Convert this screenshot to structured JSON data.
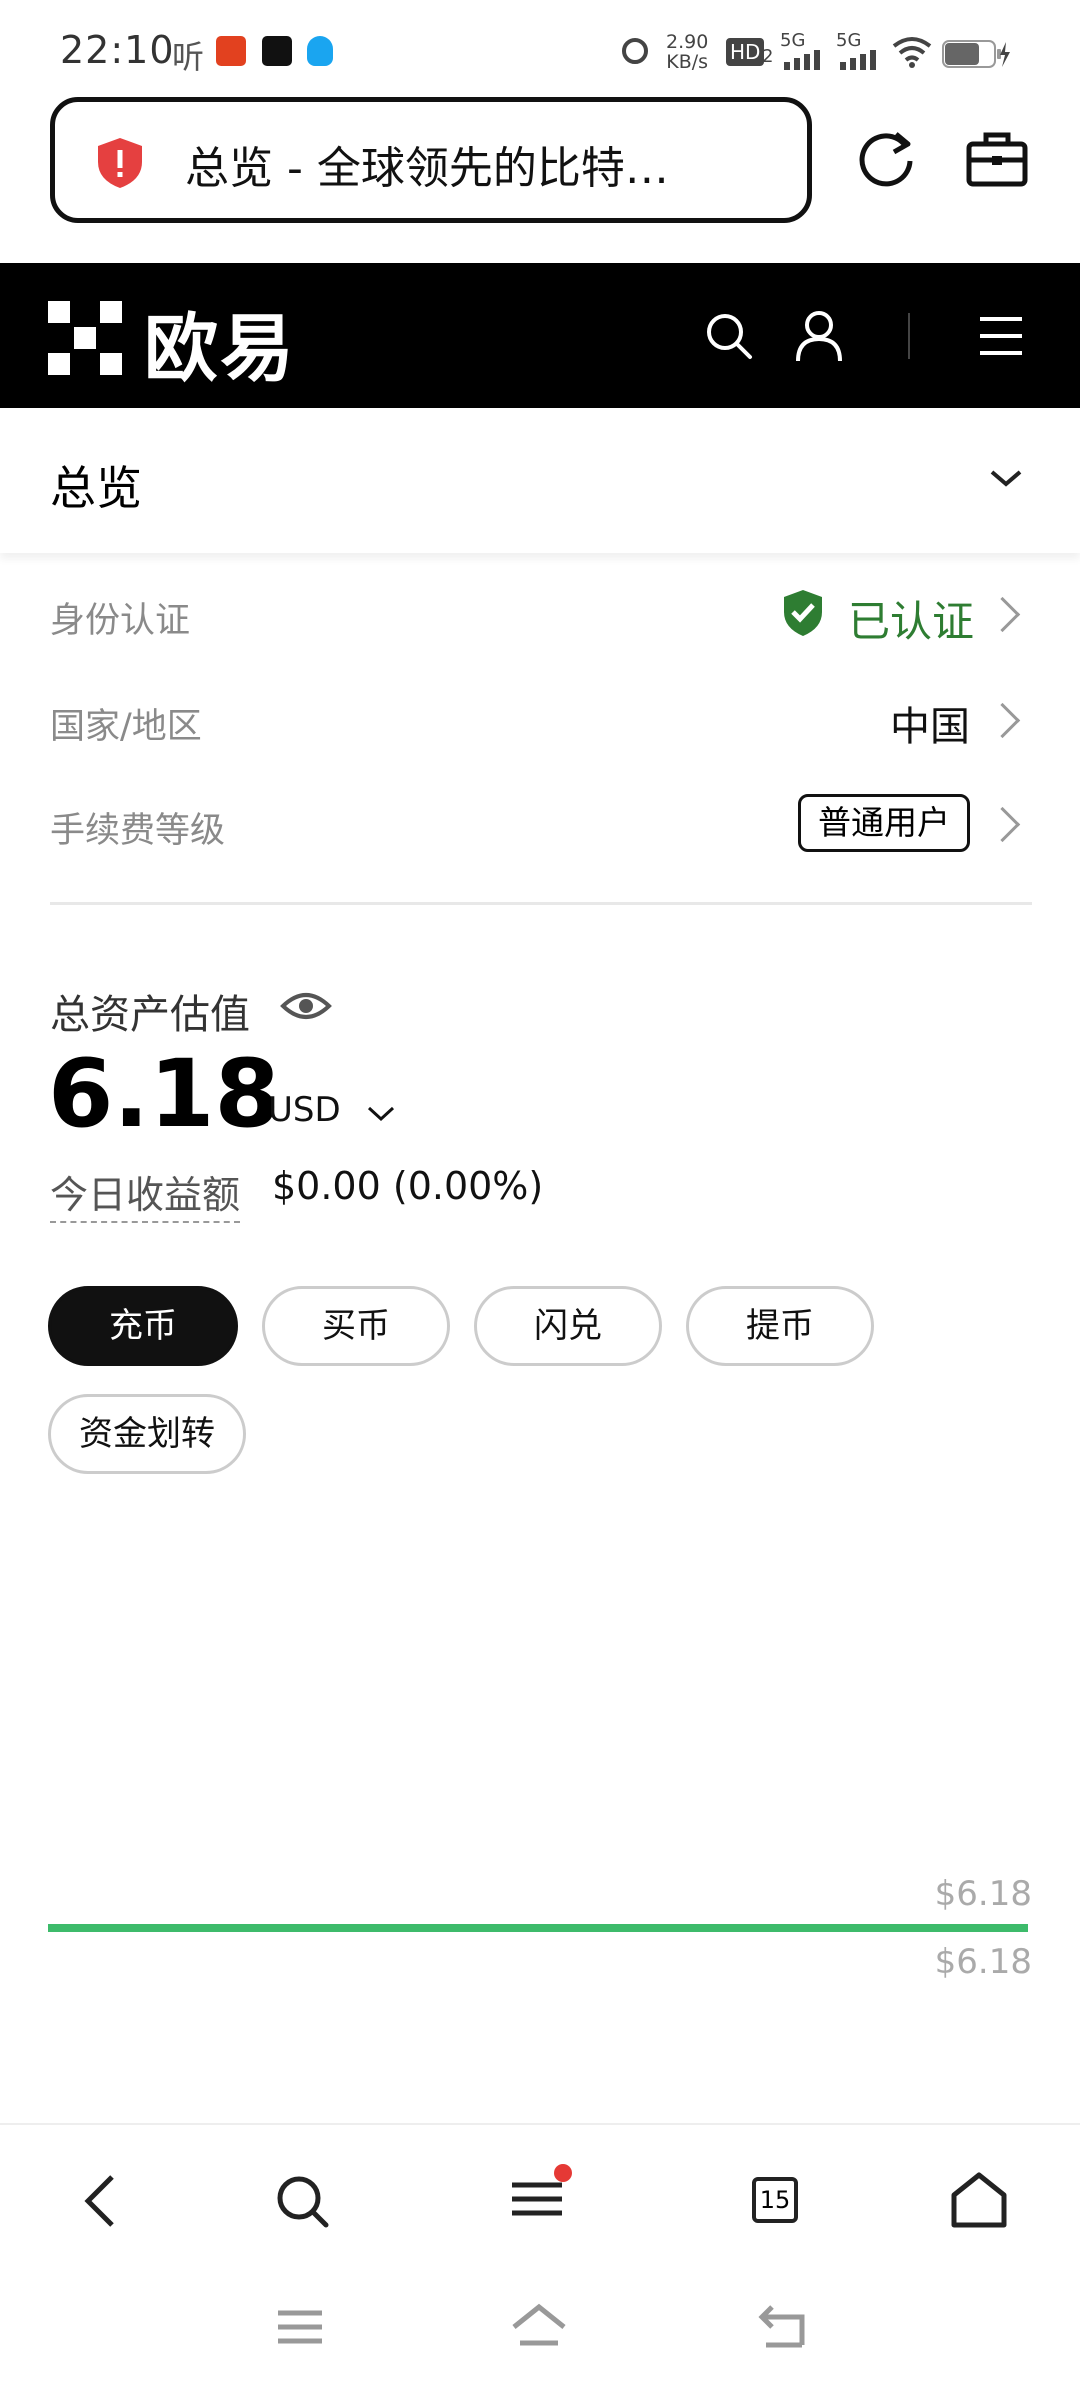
{
  "status_bar": {
    "time": "22:10",
    "ting": "听",
    "speed_top": "2.90",
    "speed_bottom": "KB/s",
    "hd": "HD",
    "hd_sub": "2",
    "net1": "5G",
    "net2": "5G"
  },
  "browser": {
    "url_title": "总览 - 全球领先的比特…"
  },
  "header": {
    "brand": "欧易"
  },
  "overview": {
    "title": "总览"
  },
  "info_rows": [
    {
      "label": "身份认证",
      "value": "已认证",
      "value_color": "#2e7d32"
    },
    {
      "label": "国家/地区",
      "value": "中国"
    },
    {
      "label": "手续费等级",
      "value": "普通用户"
    }
  ],
  "assets": {
    "label": "总资产估值",
    "amount": "6.18",
    "currency": "USD",
    "today_label": "今日收益额",
    "today_value": "$0.00 (0.00%)"
  },
  "actions": [
    "充币",
    "买币",
    "闪兑",
    "提币",
    "资金划转"
  ],
  "chart_data": {
    "type": "line",
    "series": [
      {
        "values": [
          6.18,
          6.18
        ]
      }
    ],
    "labels": [
      "$6.18",
      "$6.18"
    ],
    "line_color": "#3dbb6b"
  },
  "bottom_nav": {
    "tabs_count": "15"
  },
  "icons": {
    "shield": "shield-icon",
    "refresh": "refresh-icon",
    "toolbox": "toolbox-icon",
    "search": "search-icon",
    "user": "user-icon",
    "menu": "menu-icon",
    "eye": "eye-icon"
  }
}
